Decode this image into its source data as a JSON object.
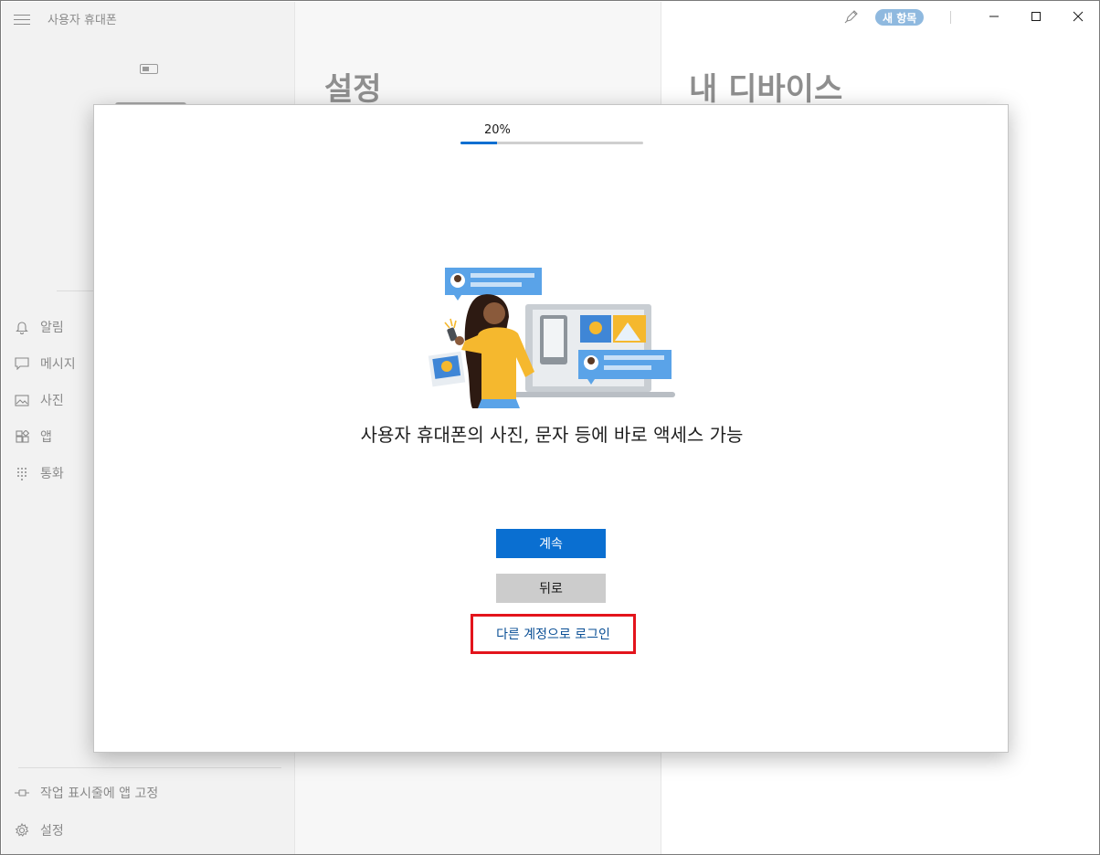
{
  "app": {
    "title": "사용자 휴대폰"
  },
  "titlebar": {
    "new_badge": "새 항목"
  },
  "sidebar": {
    "items": [
      {
        "label": "알림",
        "icon": "bell-icon"
      },
      {
        "label": "메시지",
        "icon": "message-icon"
      },
      {
        "label": "사진",
        "icon": "photo-icon"
      },
      {
        "label": "앱",
        "icon": "apps-icon"
      },
      {
        "label": "통화",
        "icon": "dialpad-icon"
      }
    ],
    "pin_label": "작업 표시줄에 앱 고정",
    "settings_label": "설정"
  },
  "middle": {
    "heading": "설정"
  },
  "right": {
    "heading": "내 디바이스"
  },
  "dialog": {
    "progress_label": "20%",
    "progress_value": 0.2,
    "headline": "사용자 휴대폰의 사진, 문자 등에 바로 액세스 가능",
    "continue_label": "계속",
    "back_label": "뒤로",
    "other_account_label": "다른 계정으로 로그인"
  },
  "colors": {
    "accent": "#0a6fd1",
    "highlight_box": "#e3141c",
    "link": "#0a4f95",
    "badge": "#8fb9df"
  }
}
